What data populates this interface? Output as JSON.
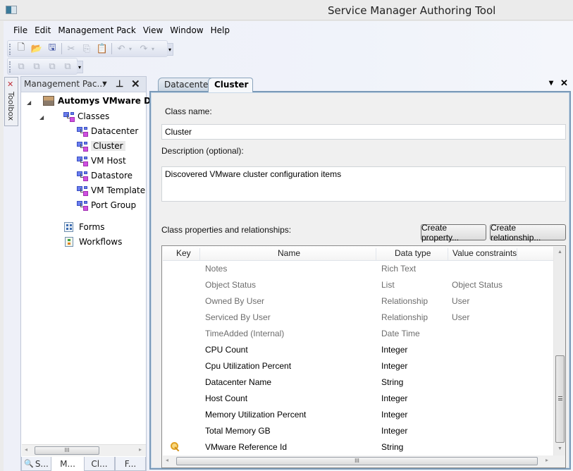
{
  "window": {
    "title": "Service Manager Authoring Tool"
  },
  "menu": [
    "File",
    "Edit",
    "Management Pack",
    "View",
    "Window",
    "Help"
  ],
  "toolbar1": {
    "buttons": [
      {
        "name": "new-icon",
        "glyph": "🗋"
      },
      {
        "name": "open-icon",
        "glyph": "📂"
      },
      {
        "name": "save-all-icon",
        "glyph": "🖫"
      },
      {
        "name": "cut-icon",
        "glyph": "✂"
      },
      {
        "name": "copy-icon",
        "glyph": "⎘"
      },
      {
        "name": "paste-icon",
        "glyph": "📋"
      },
      {
        "name": "undo-icon",
        "glyph": "↶"
      },
      {
        "name": "redo-icon",
        "glyph": "↷"
      }
    ],
    "dropdown_glyph": "▾",
    "overflow_glyph": "▾"
  },
  "toolbar2": {
    "buttons": [
      "arrange-1-icon",
      "arrange-2-icon",
      "arrange-3-icon",
      "arrange-4-icon"
    ],
    "glyph": "⧉"
  },
  "toolbox": {
    "label": "Toolbox",
    "icon_glyph": "✕"
  },
  "explorer": {
    "title": "Management Pac...",
    "dropdown_glyph": "▼",
    "pin_glyph": "⊥",
    "close_glyph": "✕",
    "pack_name": "Automys VMware Disc",
    "classes_label": "Classes",
    "expander_glyph": "◢",
    "classes": [
      "Datacenter",
      "Cluster",
      "VM Host",
      "Datastore",
      "VM Template",
      "Port Group"
    ],
    "selected_class": "Cluster",
    "forms_label": "Forms",
    "workflows_label": "Workflows",
    "scroll_left": "◂",
    "scroll_right": "▸",
    "scroll_grip": "III",
    "bottom_tabs": [
      "S...",
      "M...",
      "Cl...",
      "F..."
    ],
    "active_bottom_tab": "M..."
  },
  "document": {
    "tabs": [
      {
        "label": "Datacenter",
        "active": false
      },
      {
        "label": "Cluster",
        "active": true
      }
    ],
    "dropdown_glyph": "▾",
    "close_glyph": "✕",
    "class_name_label": "Class name:",
    "class_name_value": "Cluster",
    "description_label": "Description (optional):",
    "description_value": "Discovered VMware cluster configuration items",
    "properties_label": "Class properties and relationships:",
    "create_property_label": "Create property...",
    "create_relationship_label": "Create relationship..."
  },
  "grid": {
    "columns": [
      "Key",
      "Name",
      "Data type",
      "Value constraints"
    ],
    "rows": [
      {
        "key": false,
        "name": "Notes",
        "type": "Rich Text",
        "constraint": "",
        "inherited": true
      },
      {
        "key": false,
        "name": "Object Status",
        "type": "List",
        "constraint": "Object Status",
        "inherited": true
      },
      {
        "key": false,
        "name": "Owned By User",
        "type": "Relationship",
        "constraint": "User",
        "inherited": true
      },
      {
        "key": false,
        "name": "Serviced By User",
        "type": "Relationship",
        "constraint": "User",
        "inherited": true
      },
      {
        "key": false,
        "name": "TimeAdded (Internal)",
        "type": "Date Time",
        "constraint": "",
        "inherited": true
      },
      {
        "key": false,
        "name": "CPU Count",
        "type": "Integer",
        "constraint": "",
        "inherited": false
      },
      {
        "key": false,
        "name": "Cpu Utilization Percent",
        "type": "Integer",
        "constraint": "",
        "inherited": false
      },
      {
        "key": false,
        "name": "Datacenter Name",
        "type": "String",
        "constraint": "",
        "inherited": false
      },
      {
        "key": false,
        "name": "Host Count",
        "type": "Integer",
        "constraint": "",
        "inherited": false
      },
      {
        "key": false,
        "name": "Memory Utilization Percent",
        "type": "Integer",
        "constraint": "",
        "inherited": false
      },
      {
        "key": false,
        "name": "Total Memory GB",
        "type": "Integer",
        "constraint": "",
        "inherited": false
      },
      {
        "key": true,
        "name": "VMware Reference Id",
        "type": "String",
        "constraint": "",
        "inherited": false
      }
    ],
    "scroll_up": "▲",
    "scroll_down": "▼",
    "scroll_left": "◂",
    "scroll_right": "▸",
    "hscroll_grip": "III"
  },
  "colors": {
    "frame_border": "#7a9ab8",
    "inherited_text": "#6d6d6d",
    "selected_bg": "#e8e8e8"
  }
}
